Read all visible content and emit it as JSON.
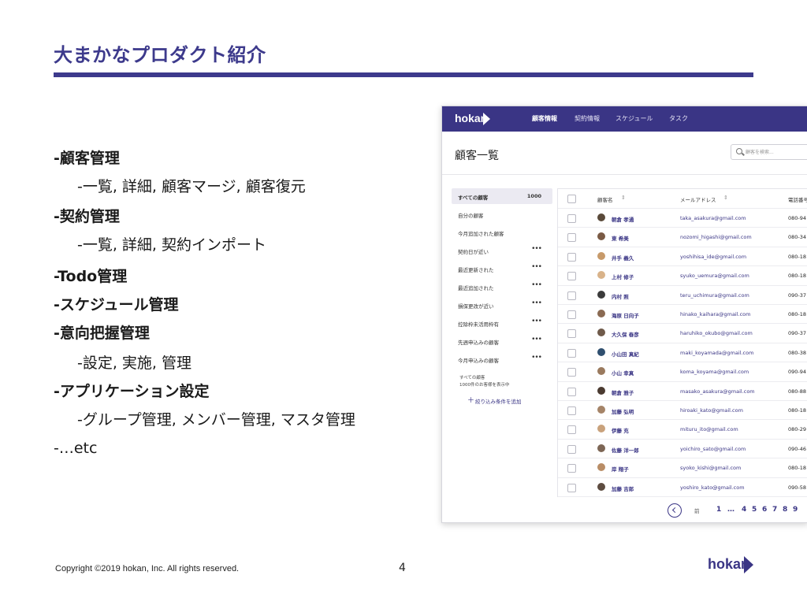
{
  "slide": {
    "title": "大まかなプロダクト紹介",
    "accent_color": "#3d3a8c",
    "bullets": [
      "-顧客管理",
      "-一覧, 詳細, 顧客マージ, 顧客復元",
      "-契約管理",
      "-一覧, 詳細, 契約インポート",
      "-Todo管理",
      "-スケジュール管理",
      "-意向把握管理",
      "-設定, 実施, 管理",
      "-アプリケーション設定",
      "-グループ管理, メンバー管理, マスタ管理",
      "-…etc"
    ]
  },
  "app": {
    "logo": "hokan",
    "nav_tabs": [
      "顧客情報",
      "契約情報",
      "スケジュール",
      "タスク"
    ],
    "page_heading": "顧客一覧",
    "search_placeholder": "顧客を検索...",
    "sidebar": {
      "items": [
        {
          "label": "すべての顧客",
          "count": "1000"
        },
        {
          "label": "自分の顧客"
        },
        {
          "label": "今月追加された顧客"
        },
        {
          "label": "契約日が近い",
          "menu": "•••"
        },
        {
          "label": "最近更新された",
          "menu": "•••"
        },
        {
          "label": "最近追加された",
          "menu": "•••"
        },
        {
          "label": "損保更改が近い",
          "menu": "•••"
        },
        {
          "label": "控除枠未活用枠有",
          "menu": "•••"
        },
        {
          "label": "先週申込みの顧客",
          "menu": "•••"
        },
        {
          "label": "今月申込みの顧客",
          "menu": "•••"
        }
      ],
      "note_line1": "すべての顧客",
      "note_line2": "1000件のお客様を表示中",
      "add_filter_plus": "＋",
      "add_filter": "絞り込み条件を追加"
    },
    "table": {
      "headers": [
        "顧客名",
        "メールアドレス",
        "電話番号"
      ],
      "sort_glyph": "⇕",
      "rows": [
        {
          "name": "朝倉 孝通",
          "email": "taka_asakura@gmail.com",
          "phone": "080-94"
        },
        {
          "name": "東 希美",
          "email": "nozomi_higashi@gmail.com",
          "phone": "080-34"
        },
        {
          "name": "井手 義久",
          "email": "yoshihisa_ide@gmail.com",
          "phone": "080-18"
        },
        {
          "name": "上村 修子",
          "email": "syuko_uemura@gmail.com",
          "phone": "080-18"
        },
        {
          "name": "内村 照",
          "email": "teru_uchimura@gmail.com",
          "phone": "090-37"
        },
        {
          "name": "海原 日向子",
          "email": "hinako_kaihara@gmail.com",
          "phone": "080-18"
        },
        {
          "name": "大久保 春彦",
          "email": "haruhiko_okubo@gmail.com",
          "phone": "090-37"
        },
        {
          "name": "小山田 真紀",
          "email": "maki_koyamada@gmail.com",
          "phone": "080-38"
        },
        {
          "name": "小山 幸真",
          "email": "koma_koyama@gmail.com",
          "phone": "090-94"
        },
        {
          "name": "朝倉 雅子",
          "email": "masako_asakura@gmail.com",
          "phone": "080-88"
        },
        {
          "name": "加藤 弘明",
          "email": "hiroaki_kato@gmail.com",
          "phone": "080-18"
        },
        {
          "name": "伊藤 充",
          "email": "mituru_ito@gmail.com",
          "phone": "080-29"
        },
        {
          "name": "佐藤 洋一郎",
          "email": "yoichiro_sato@gmail.com",
          "phone": "090-46"
        },
        {
          "name": "岸 翔子",
          "email": "syoko_kishi@gmail.com",
          "phone": "080-18"
        },
        {
          "name": "加藤 吉郎",
          "email": "yoshiro_kato@gmail.com",
          "phone": "090-58"
        }
      ],
      "avatar_colors": [
        "#5a4a3a",
        "#7a5a44",
        "#c79a6a",
        "#d9b38a",
        "#3b3b3b",
        "#8a6a52",
        "#6f5a4a",
        "#2f4f6f",
        "#9a7a5e",
        "#4a3a30",
        "#a58468",
        "#c9a27c",
        "#7d6655",
        "#b98d66",
        "#5d4c40"
      ]
    },
    "pagination": {
      "prev_label": "前",
      "pages": [
        "1",
        "…",
        "4",
        "5",
        "6",
        "7",
        "8",
        "9"
      ]
    }
  },
  "footer": {
    "copyright": "Copyright ©2019 hokan, Inc. All rights reserved.",
    "page_number": "4",
    "logo": "hokan"
  }
}
